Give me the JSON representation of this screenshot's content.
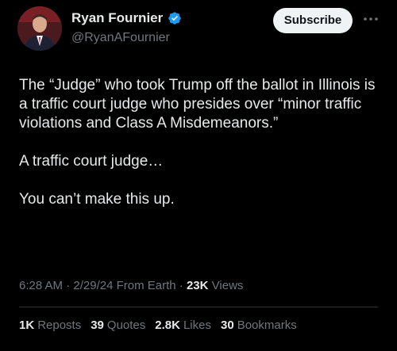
{
  "author": {
    "display_name": "Ryan Fournier",
    "handle": "@RyanAFournier",
    "verified": true,
    "verified_color": "#1d9bf0"
  },
  "actions": {
    "subscribe_label": "Subscribe",
    "more_icon": "more-horizontal-icon"
  },
  "tweet": {
    "paragraphs": [
      "The “Judge” who took Trump off the ballot in Illinois is a traffic court judge who presides over “minor traffic violations and Class A Misdemeanors.”",
      "A traffic court judge…",
      "You can’t make this up."
    ]
  },
  "meta": {
    "time": "6:28 AM",
    "date": "2/29/24",
    "source": "From Earth",
    "views_count": "23K",
    "views_label": "Views"
  },
  "stats": [
    {
      "count": "1K",
      "label": "Reposts"
    },
    {
      "count": "39",
      "label": "Quotes"
    },
    {
      "count": "2.8K",
      "label": "Likes"
    },
    {
      "count": "30",
      "label": "Bookmarks"
    }
  ],
  "colors": {
    "background": "#000000",
    "text": "#e7e9ea",
    "muted": "#71767b",
    "divider": "#2f3336",
    "button_bg": "#eff3f4"
  }
}
